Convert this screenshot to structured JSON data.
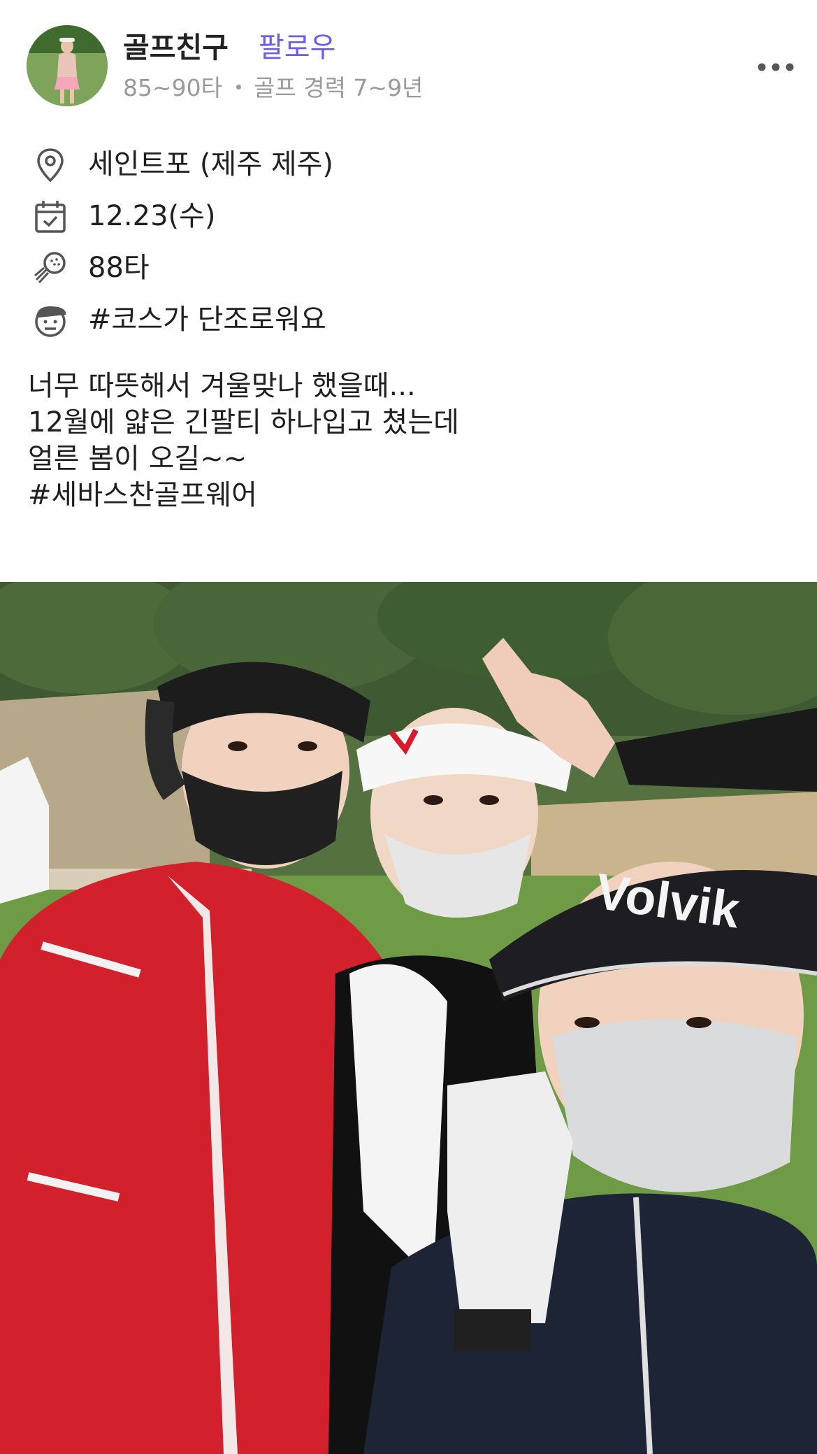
{
  "post": {
    "author": {
      "name": "골프친구",
      "follow_label": "팔로우",
      "score_range": "85~90타",
      "experience": "골프 경력 7~9년"
    },
    "more_icon": "more-horizontal-icon",
    "details": [
      {
        "icon": "location-pin-icon",
        "text": "세인트포 (제주 제주)"
      },
      {
        "icon": "calendar-check-icon",
        "text": "12.23(수)"
      },
      {
        "icon": "golf-ball-icon",
        "text": "88타"
      },
      {
        "icon": "face-emoji-icon",
        "text": "#코스가 단조로워요"
      }
    ],
    "caption_lines": [
      "너무 따뜻해서 겨울맞나 했을때...",
      "12월에 얇은 긴팔티 하나입고 쳤는데",
      "얼른 봄이 오길~~",
      "#세바스찬골프웨어"
    ],
    "photo": {
      "visor_brand_text": "Volvik"
    }
  },
  "colors": {
    "accent": "#6c5ce7",
    "muted": "#9a9a9a",
    "text": "#1f1f1f"
  }
}
